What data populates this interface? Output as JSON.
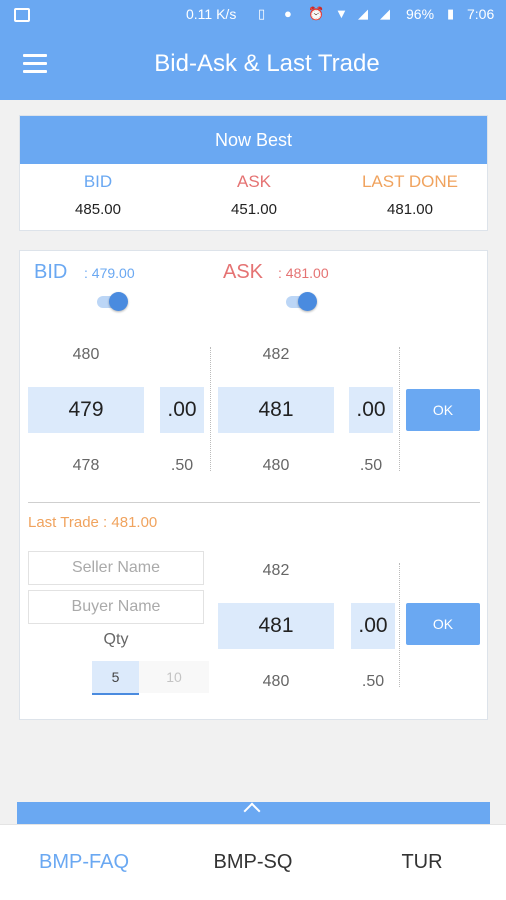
{
  "status_bar": {
    "speed": "0.11 K/s",
    "battery": "96%",
    "time": "7:06",
    "icons": [
      "gallery-icon",
      "phone-icon",
      "location-icon",
      "alarm-icon",
      "wifi-icon",
      "signal-icon",
      "signal-icon",
      "battery-icon"
    ]
  },
  "app_bar": {
    "title": "Bid-Ask & Last Trade"
  },
  "now_best": {
    "title": "Now Best",
    "columns": [
      {
        "label": "BID",
        "value": "485.00",
        "color": "#6aa8f2"
      },
      {
        "label": "ASK",
        "value": "451.00",
        "color": "#e57373"
      },
      {
        "label": "LAST DONE",
        "value": "481.00",
        "color": "#f0a35e"
      }
    ]
  },
  "bid_ask": {
    "bid_label": "BID",
    "bid_value": ": 479.00",
    "bid_color": "#6aa8f2",
    "ask_label": "ASK",
    "ask_value": ": 481.00",
    "ask_color": "#e57373",
    "bid_whole": {
      "above": "480",
      "current": "479",
      "below": "478"
    },
    "bid_frac": {
      "current": ".00",
      "below": ".50"
    },
    "ask_whole": {
      "above": "482",
      "current": "481",
      "below": "480"
    },
    "ask_frac": {
      "current": ".00",
      "below": ".50"
    },
    "ok_label": "OK"
  },
  "last_trade": {
    "label": "Last Trade : 481.00",
    "color": "#f0a35e",
    "seller_placeholder": "Seller Name",
    "buyer_placeholder": "Buyer Name",
    "qty_label": "Qty",
    "qty_options": [
      "5",
      "10"
    ],
    "price_whole": {
      "above": "482",
      "current": "481",
      "below": "480"
    },
    "price_frac": {
      "current": ".00",
      "below": ".50"
    },
    "ok_label": "OK"
  },
  "bottom_nav": [
    {
      "label": "BMP-FAQ",
      "active": true
    },
    {
      "label": "BMP-SQ",
      "active": false
    },
    {
      "label": "TUR",
      "active": false
    }
  ],
  "colors": {
    "accent": "#6aa8f2",
    "field_bg": "#dceafb"
  }
}
